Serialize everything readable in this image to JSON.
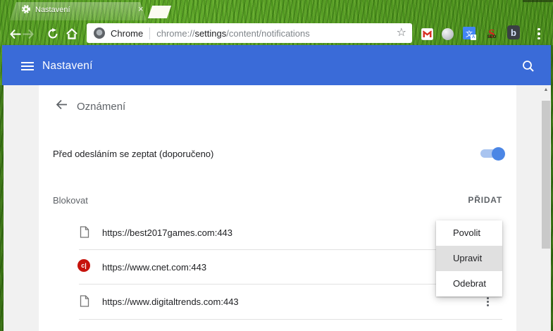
{
  "window": {
    "tab_title": "Nastavení",
    "close_glyph": "×"
  },
  "toolbar": {
    "origin_label": "Chrome",
    "url_scheme": "chrome://",
    "url_host": "settings",
    "url_path": "/content/notifications",
    "star_glyph": "☆",
    "extensions": [
      {
        "name": "gmail"
      },
      {
        "name": "gray-sphere"
      },
      {
        "name": "translate",
        "glyph": "文",
        "mini_glyph": "A"
      },
      {
        "name": "seo",
        "letter": "S",
        "glyph": "SEO"
      },
      {
        "name": "b-extension",
        "glyph": "b"
      }
    ]
  },
  "settings_header": {
    "title": "Nastavení"
  },
  "content": {
    "heading": "Oznámení",
    "ask_toggle": {
      "label": "Před odesláním se zeptat (doporučeno)",
      "state_on": true
    },
    "block_section": {
      "title": "Blokovat",
      "add_button": "PŘIDAT"
    },
    "sites": [
      {
        "url": "https://best2017games.com:443",
        "icon": "page"
      },
      {
        "url": "https://www.cnet.com:443",
        "icon": "cnet-favicon",
        "favicon_text": "c|"
      },
      {
        "url": "https://www.digitaltrends.com:443",
        "icon": "page"
      }
    ],
    "context_menu": {
      "items": [
        "Povolit",
        "Upravit",
        "Odebrat"
      ],
      "highlighted_index": 1
    }
  },
  "scrollbar": {
    "up_arrow": "▲"
  },
  "colors": {
    "header_blue": "#3a6bd8",
    "toggle_blue": "#4b86e5",
    "cnet_red": "#c6130c",
    "menu_highlight": "#e0e0e0",
    "page_bg": "#f1f1f1"
  }
}
